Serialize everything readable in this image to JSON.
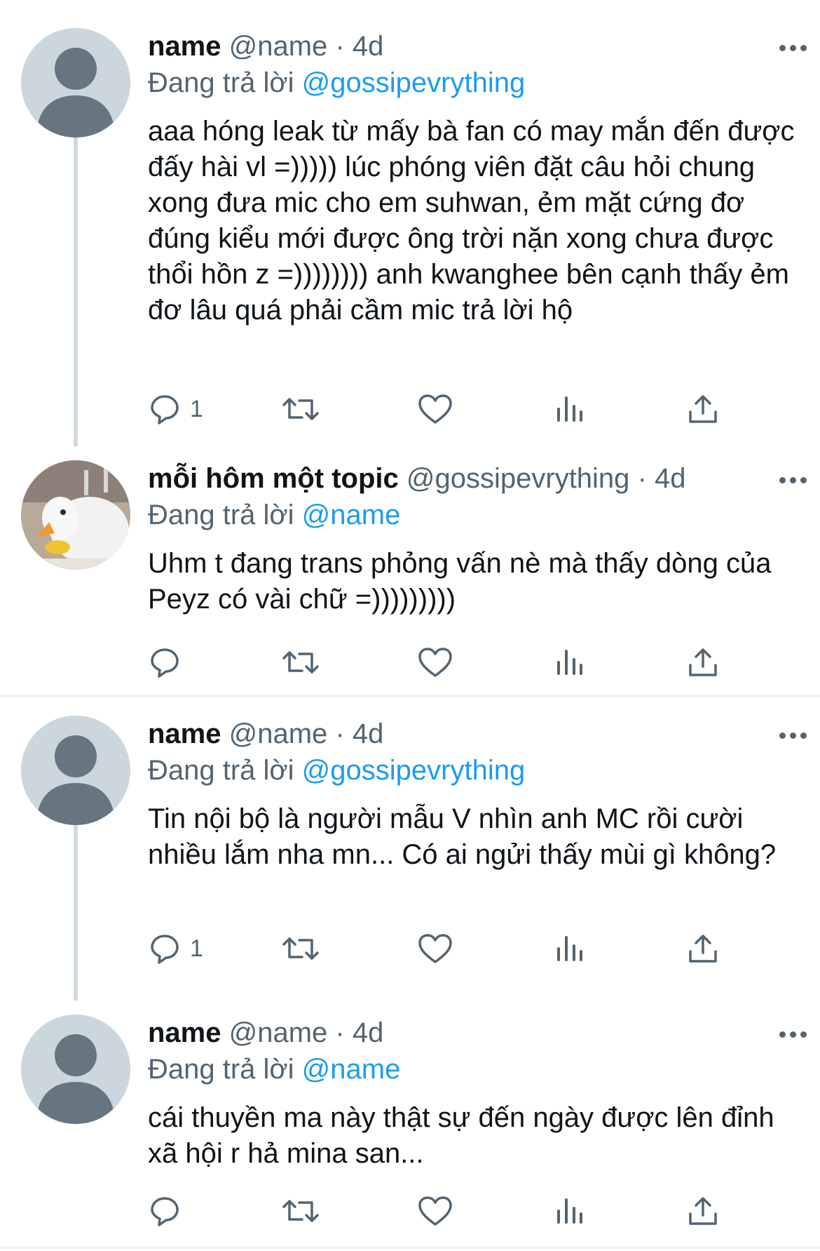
{
  "reply_prefix": "Đang trả lời",
  "tweets": [
    {
      "display_name": "name",
      "handle": "@name",
      "time": "4d",
      "reply_to": "@gossipevrything",
      "text": "aaa hóng leak từ mấy bà fan có may mắn đến được đấy hài vl =))))) lúc phóng viên đặt câu hỏi chung xong đưa mic cho em suhwan, ẻm mặt cứng đơ đúng kiểu mới được ông trời nặn xong chưa được thổi hồn z =)))))))) anh kwanghee bên cạnh thấy ẻm đơ lâu quá phải cầm mic trả lời hộ",
      "reply_count": "1"
    },
    {
      "display_name": "mỗi hôm một topic",
      "handle": "@gossipevrything",
      "time": "4d",
      "reply_to": "@name",
      "text": "Uhm t đang trans phỏng vấn nè mà thấy dòng của Peyz có vài chữ =)))))))))",
      "reply_count": ""
    },
    {
      "display_name": "name",
      "handle": "@name",
      "time": "4d",
      "reply_to": "@gossipevrything",
      "text": "Tin nội bộ là người mẫu V nhìn anh MC rồi cười nhiều lắm nha mn... Có ai ngửi thấy mùi gì không?",
      "reply_count": "1"
    },
    {
      "display_name": "name",
      "handle": "@name",
      "time": "4d",
      "reply_to": "@name",
      "text": "cái thuyền ma này thật sự đến ngày được lên đỉnh xã hội r hả mina san...",
      "reply_count": ""
    }
  ],
  "icons": {
    "reply": "speech-bubble-icon",
    "retweet": "retweet-icon",
    "like": "heart-icon",
    "analytics": "bar-chart-icon",
    "share": "share-upload-icon",
    "more": "ellipsis-icon"
  },
  "colors": {
    "link": "#1d9bf0",
    "secondary_text": "#536471",
    "thread_line": "#cfd9de",
    "avatar_placeholder": "#ccd6dd"
  }
}
